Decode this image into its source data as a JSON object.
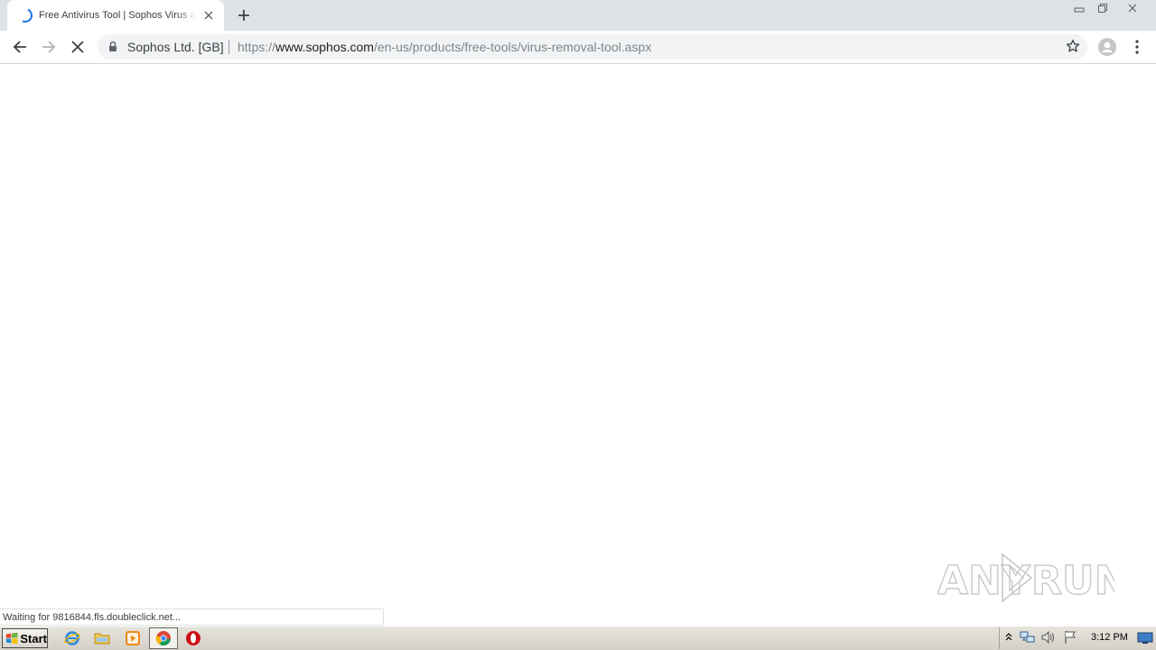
{
  "browser": {
    "tab": {
      "title": "Free Antivirus Tool | Sophos Virus and Spyware Removal Tool"
    },
    "toolbar": {
      "site_identity": "Sophos Ltd. [GB]",
      "url_scheme": "https://",
      "url_host": "www.sophos.com",
      "url_path": "/en-us/products/free-tools/virus-removal-tool.aspx"
    },
    "status": "Waiting for 9816844.fls.doubleclick.net..."
  },
  "watermark": {
    "text_left": "ANY",
    "text_right": "RUN"
  },
  "taskbar": {
    "start_label": "Start",
    "clock": "3:12 PM"
  },
  "colors": {
    "tabstrip": "#dee1e6",
    "accent_spinner": "#1a73e8",
    "omnibox": "#f1f3f4",
    "taskbar": "#d4d0c8"
  },
  "icons": {
    "tab": [
      "loading-spinner-icon",
      "close-icon"
    ],
    "toolbar": [
      "back-arrow-icon",
      "forward-arrow-icon",
      "stop-loading-icon",
      "lock-icon",
      "star-icon",
      "profile-icon",
      "menu-icon"
    ],
    "taskbar": [
      "windows-flag-icon",
      "internet-explorer-icon",
      "folder-icon",
      "media-player-icon",
      "chrome-icon",
      "opera-icon"
    ],
    "tray": [
      "show-hidden-icons-icon",
      "network-icon",
      "volume-icon",
      "action-center-flag-icon",
      "show-desktop-icon"
    ]
  }
}
